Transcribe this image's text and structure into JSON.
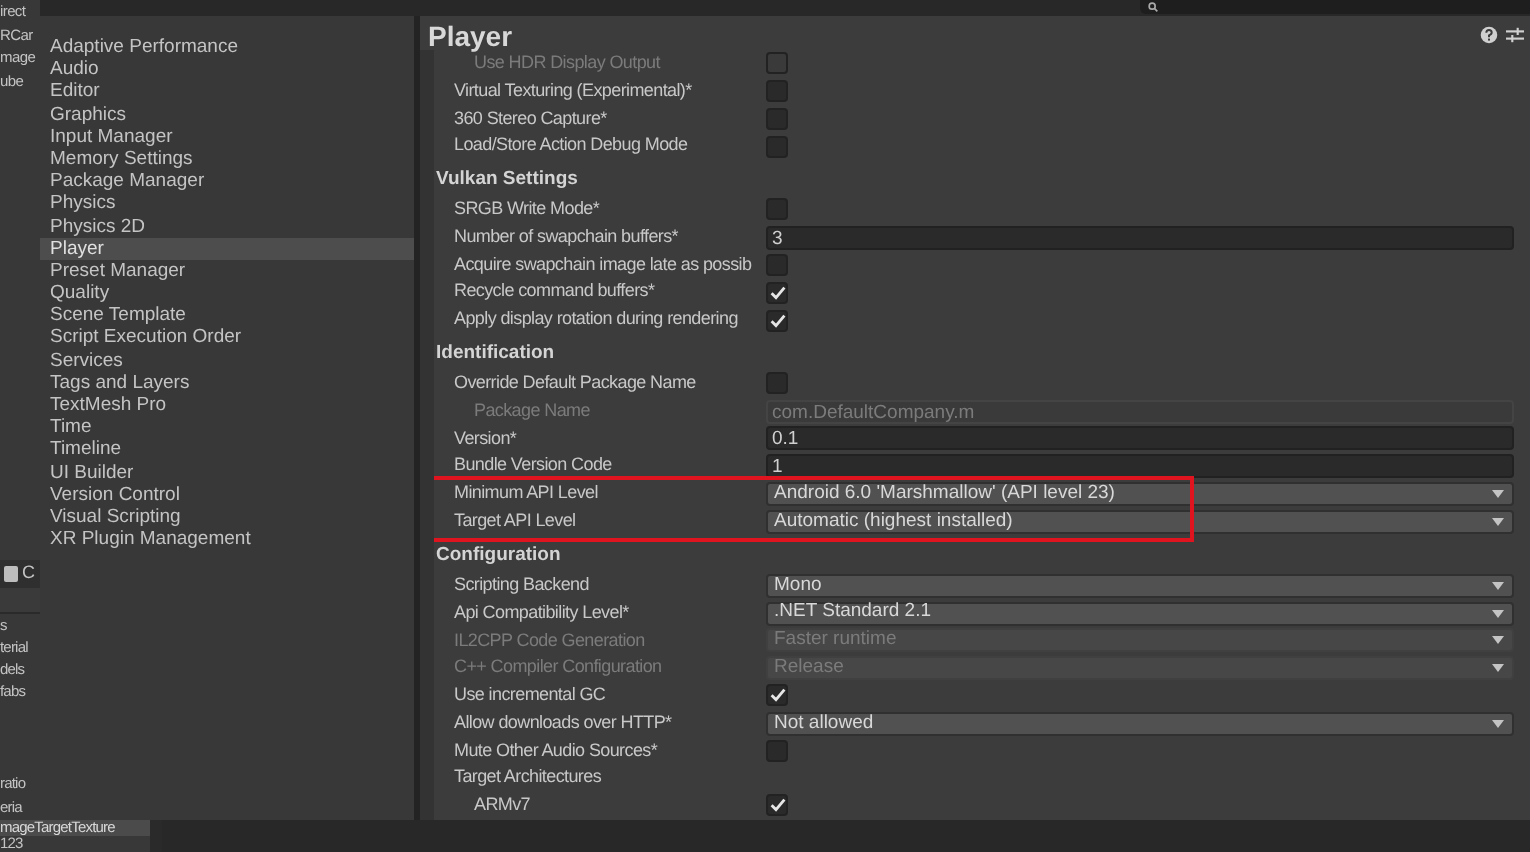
{
  "left_panel": {
    "top_items": [
      "irect",
      "RCar",
      "mage",
      "ube"
    ],
    "tab": {
      "label": "C"
    },
    "middle_items": [
      "s",
      "terial",
      "dels",
      "fabs"
    ],
    "bottom_items": [
      {
        "label": "ratio",
        "selected": false
      },
      {
        "label": "eria",
        "selected": false
      },
      {
        "label": "mageTargetTexture",
        "selected": true
      },
      {
        "label": "123",
        "selected": false
      }
    ]
  },
  "sidebar": {
    "items": [
      {
        "label": "Adaptive Performance",
        "selected": false
      },
      {
        "label": "Audio",
        "selected": false
      },
      {
        "label": "Editor",
        "selected": false
      },
      {
        "label": "Graphics",
        "selected": false
      },
      {
        "label": "Input Manager",
        "selected": false
      },
      {
        "label": "Memory Settings",
        "selected": false
      },
      {
        "label": "Package Manager",
        "selected": false
      },
      {
        "label": "Physics",
        "selected": false
      },
      {
        "label": "Physics 2D",
        "selected": false
      },
      {
        "label": "Player",
        "selected": true
      },
      {
        "label": "Preset Manager",
        "selected": false
      },
      {
        "label": "Quality",
        "selected": false
      },
      {
        "label": "Scene Template",
        "selected": false
      },
      {
        "label": "Script Execution Order",
        "selected": false
      },
      {
        "label": "Services",
        "selected": false
      },
      {
        "label": "Tags and Layers",
        "selected": false
      },
      {
        "label": "TextMesh Pro",
        "selected": false
      },
      {
        "label": "Time",
        "selected": false
      },
      {
        "label": "Timeline",
        "selected": false
      },
      {
        "label": "UI Builder",
        "selected": false
      },
      {
        "label": "Version Control",
        "selected": false
      },
      {
        "label": "Visual Scripting",
        "selected": false
      },
      {
        "label": "XR Plugin Management",
        "selected": false
      }
    ]
  },
  "panel": {
    "title": "Player",
    "sections": [
      {
        "items": [
          {
            "kind": "checkbox",
            "label": "Use HDR Display Output",
            "checked": false,
            "disabled": true,
            "highlighted": false,
            "indented": true
          },
          {
            "kind": "checkbox",
            "label": "Virtual Texturing (Experimental)*",
            "checked": false,
            "disabled": false,
            "highlighted": false,
            "indented": false
          },
          {
            "kind": "checkbox",
            "label": "360 Stereo Capture*",
            "checked": false,
            "disabled": false,
            "highlighted": false,
            "indented": false
          },
          {
            "kind": "checkbox",
            "label": "Load/Store Action Debug Mode",
            "checked": false,
            "disabled": false,
            "highlighted": false,
            "indented": false
          }
        ]
      },
      {
        "heading": "Vulkan Settings",
        "items": [
          {
            "kind": "checkbox",
            "label": "SRGB Write Mode*",
            "checked": false,
            "disabled": false,
            "highlighted": false,
            "indented": false
          },
          {
            "kind": "text",
            "label": "Number of swapchain buffers*",
            "value": "3",
            "disabled": false,
            "highlighted": false,
            "indented": false
          },
          {
            "kind": "checkbox",
            "label": "Acquire swapchain image late as possib",
            "checked": false,
            "disabled": false,
            "highlighted": false,
            "indented": false
          },
          {
            "kind": "checkbox",
            "label": "Recycle command buffers*",
            "checked": true,
            "disabled": false,
            "highlighted": false,
            "indented": false
          },
          {
            "kind": "checkbox",
            "label": "Apply display rotation during rendering",
            "checked": true,
            "disabled": false,
            "highlighted": false,
            "indented": false
          }
        ]
      },
      {
        "heading": "Identification",
        "items": [
          {
            "kind": "checkbox",
            "label": "Override Default Package Name",
            "checked": false,
            "disabled": false,
            "highlighted": false,
            "indented": false
          },
          {
            "kind": "text",
            "label": "Package Name",
            "value": "com.DefaultCompany.m",
            "disabled": true,
            "highlighted": false,
            "indented": true
          },
          {
            "kind": "text",
            "label": "Version*",
            "value": "0.1",
            "disabled": false,
            "highlighted": false,
            "indented": false
          },
          {
            "kind": "text",
            "label": "Bundle Version Code",
            "value": "1",
            "disabled": false,
            "highlighted": false,
            "indented": false
          },
          {
            "kind": "dropdown",
            "label": "Minimum API Level",
            "value": "Android 6.0 'Marshmallow' (API level 23)",
            "disabled": false,
            "highlighted": true,
            "indented": false
          },
          {
            "kind": "dropdown",
            "label": "Target API Level",
            "value": "Automatic (highest installed)",
            "disabled": false,
            "highlighted": true,
            "indented": false
          }
        ]
      },
      {
        "heading": "Configuration",
        "items": [
          {
            "kind": "dropdown",
            "label": "Scripting Backend",
            "value": "Mono",
            "disabled": false,
            "highlighted": false,
            "indented": false
          },
          {
            "kind": "dropdown",
            "label": "Api Compatibility Level*",
            "value": ".NET Standard 2.1",
            "disabled": false,
            "highlighted": false,
            "indented": false
          },
          {
            "kind": "dropdown",
            "label": "IL2CPP Code Generation",
            "value": "Faster runtime",
            "disabled": true,
            "highlighted": false,
            "indented": false
          },
          {
            "kind": "dropdown",
            "label": "C++ Compiler Configuration",
            "value": "Release",
            "disabled": true,
            "highlighted": false,
            "indented": false
          },
          {
            "kind": "checkbox",
            "label": "Use incremental GC",
            "checked": true,
            "disabled": false,
            "highlighted": false,
            "indented": false
          },
          {
            "kind": "dropdown",
            "label": "Allow downloads over HTTP*",
            "value": "Not allowed",
            "disabled": false,
            "highlighted": false,
            "indented": false
          },
          {
            "kind": "checkbox",
            "label": "Mute Other Audio Sources*",
            "checked": false,
            "disabled": false,
            "highlighted": false,
            "indented": false
          },
          {
            "kind": "label",
            "label": "Target Architectures",
            "disabled": false,
            "highlighted": false,
            "indented": false
          },
          {
            "kind": "checkbox",
            "label": "ARMv7",
            "checked": true,
            "disabled": false,
            "highlighted": false,
            "indented": true
          }
        ]
      }
    ]
  }
}
